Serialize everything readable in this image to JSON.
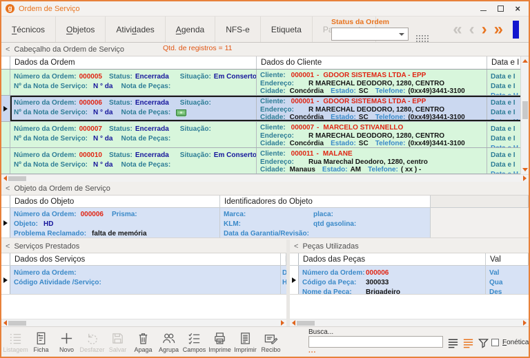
{
  "ui": {
    "collapse_glyph": "<"
  },
  "window": {
    "title": "Ordem de Serviço",
    "logo_letter": "g",
    "close_glyph": "×"
  },
  "tabs": {
    "items": [
      {
        "pre": "",
        "accel": "T",
        "post": "écnicos"
      },
      {
        "pre": "",
        "accel": "O",
        "post": "bjetos"
      },
      {
        "pre": "Ativi",
        "accel": "d",
        "post": "ades"
      },
      {
        "pre": "",
        "accel": "A",
        "post": "genda"
      },
      {
        "pre": "NFS-e",
        "accel": "",
        "post": ""
      },
      {
        "pre": "Etiqueta",
        "accel": "",
        "post": ""
      },
      {
        "pre": "Pagamento",
        "accel": "",
        "post": ""
      }
    ],
    "status_label": "Status da Ordem",
    "status_value": ""
  },
  "nav": {
    "first": "«",
    "prev": "‹",
    "next": "›",
    "last": "»"
  },
  "header_section": {
    "title": "Cabeçalho da Ordem de Serviço",
    "record_count": "Qtd. de registros = 11"
  },
  "grid": {
    "header": {
      "ordem": "Dados da Ordem",
      "cliente": "Dados do Cliente",
      "data": "Data e I"
    },
    "labels": {
      "numero": "Número da Ordem:",
      "status": "Status:",
      "situacao": "Situação:",
      "nota_servico": "Nº da Nota de Serviço:",
      "n_da": "N ° da",
      "nota_pecas": "Nota de Peças:",
      "cliente": "Cliente:",
      "dash": "-",
      "endereco": "Endereço:",
      "cidade": "Cidade:",
      "estado": "Estado:",
      "telefone": "Telefone:",
      "data_lines": [
        "Data e I",
        "Data e I",
        "Data e H"
      ]
    },
    "rows": [
      {
        "num": "000005",
        "status": "Encerrada",
        "situacao": "Em Conserto",
        "selected": false,
        "money": false,
        "cliente_num": "000001",
        "cliente_nome": "GDOOR SISTEMAS LTDA - EPP",
        "endereco": "R MARECHAL DEODORO, 1280, CENTRO",
        "cidade": "Concórdia",
        "estado": "SC",
        "telefone": "(0xx49)3441-3100"
      },
      {
        "num": "000006",
        "status": "Encerrada",
        "situacao": "",
        "selected": true,
        "money": true,
        "cliente_num": "000001",
        "cliente_nome": "GDOOR SISTEMAS LTDA - EPP",
        "endereco": "R MARECHAL DEODORO, 1280, CENTRO",
        "cidade": "Concórdia",
        "estado": "SC",
        "telefone": "(0xx49)3441-3100"
      },
      {
        "num": "000007",
        "status": "Encerrada",
        "situacao": "",
        "selected": false,
        "money": false,
        "cliente_num": "000007",
        "cliente_nome": "MARCELO STIVANELLO",
        "endereco": "R MARECHAL DEODORO, 1280, CENTRO",
        "cidade": "Concórdia",
        "estado": "SC",
        "telefone": "(0xx49)3441-3100"
      },
      {
        "num": "000010",
        "status": "Encerrada",
        "situacao": "Em Conserto",
        "selected": false,
        "money": false,
        "cliente_num": "000011",
        "cliente_nome": "MALANE",
        "endereco": "Rua Marechal Deodoro, 1280, centro",
        "cidade": "Manaus",
        "estado": "AM",
        "telefone": "( xx )   -"
      }
    ]
  },
  "objeto_section": {
    "title": "Objeto da Ordem de Serviço",
    "columns": {
      "dados": "Dados do Objeto",
      "ident": "Identificadores do Objeto"
    },
    "labels": {
      "numero": "Número da Ordem:",
      "prisma": "Prisma:",
      "objeto": "Objeto:",
      "problema": "Problema Reclamado:",
      "marca": "Marca:",
      "placa": "placa:",
      "klm": "KLM:",
      "qtd_gasolina": "qtd gasolina:",
      "garantia": "Data da Garantia/Revisão:"
    },
    "record": {
      "numero": "000006",
      "objeto": "HD",
      "problema": "falta de memória"
    }
  },
  "servicos_section": {
    "title": "Serviços Prestados",
    "columns": {
      "dados": "Dados dos Serviços",
      "clipped": "D"
    },
    "labels": {
      "numero": "Número da Ordem:",
      "codigo": "Código Atividade /Serviço:",
      "clip1": "D",
      "clip2": "H"
    }
  },
  "pecas_section": {
    "title": "Peças Utilizadas",
    "columns": {
      "dados": "Dados das Peças",
      "valores": "Val"
    },
    "labels": {
      "numero": "Número da Ordem:",
      "codigo": "Código da Peça:",
      "nome": "Nome da Peça:",
      "val": "Val",
      "qua": "Qua",
      "des": "Des"
    },
    "record": {
      "numero": "000006",
      "codigo": "300033",
      "nome": "Brigadeiro"
    }
  },
  "toolbar": {
    "buttons": [
      {
        "label": "Listagem",
        "disabled": true
      },
      {
        "label": "Ficha",
        "disabled": false
      },
      {
        "label": "Novo",
        "disabled": false
      },
      {
        "label": "Desfazer",
        "disabled": true
      },
      {
        "label": "Salvar",
        "disabled": true
      },
      {
        "label": "Apaga",
        "disabled": false
      },
      {
        "label": "Agrupa",
        "disabled": false
      },
      {
        "label": "Campos",
        "disabled": false
      },
      {
        "label": "Imprime",
        "disabled": false
      },
      {
        "label": "Imprimir",
        "disabled": false
      },
      {
        "label": "Recibo",
        "disabled": false
      }
    ]
  },
  "search": {
    "label": "Busca...",
    "value": "",
    "dots": "...",
    "fonetica_accel": "F",
    "fonetica_post": "onética"
  },
  "colors": {
    "accent_orange": "#E8741F",
    "row_green": "#D8F6DC",
    "row_selected": "#CBD8F0",
    "label_teal": "#2E7D96",
    "label_blue": "#3A89C8",
    "value_navy": "#15159B",
    "value_red": "#E02412",
    "nav_blue": "#1316CE"
  }
}
